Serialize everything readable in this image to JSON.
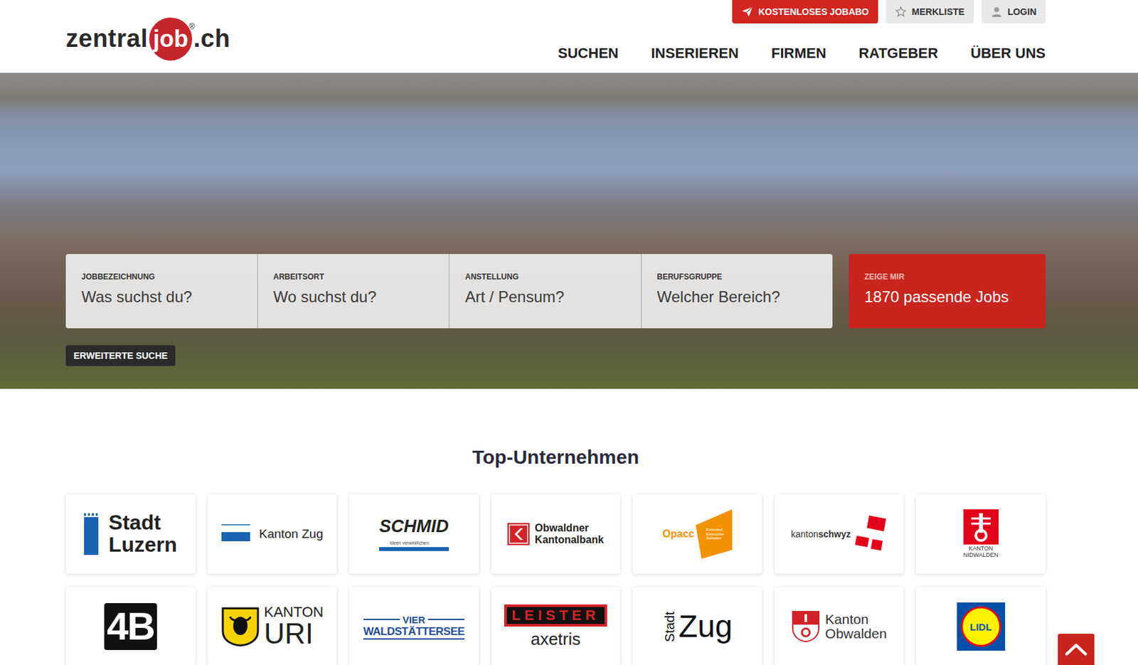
{
  "header": {
    "logo": {
      "before": "zentral",
      "highlight": "job",
      "mark": "®",
      "suffix": ".ch"
    },
    "top_buttons": [
      {
        "label": "KOSTENLOSES JOBABO",
        "kind": "primary"
      },
      {
        "label": "MERKLISTE",
        "kind": "star"
      },
      {
        "label": "LOGIN",
        "kind": "user"
      }
    ],
    "nav": [
      "SUCHEN",
      "INSERIEREN",
      "FIRMEN",
      "RATGEBER",
      "ÜBER UNS"
    ]
  },
  "search": {
    "fields": [
      {
        "label": "JOBBEZEICHNUNG",
        "placeholder": "Was suchst du?"
      },
      {
        "label": "ARBEITSORT",
        "placeholder": "Wo suchst du?"
      },
      {
        "label": "ANSTELLUNG",
        "placeholder": "Art / Pensum?"
      },
      {
        "label": "BERUFSGRUPPE",
        "placeholder": "Welcher Bereich?"
      }
    ],
    "submit": {
      "label": "ZEIGE MIR",
      "text": "1870 passende Jobs"
    },
    "advanced": "ERWEITERTE SUCHE"
  },
  "companies": {
    "title": "Top-Unternehmen",
    "items": [
      {
        "kind": "bar",
        "lines": [
          "Stadt",
          "Luzern"
        ],
        "color": "#1a64b4"
      },
      {
        "kind": "stripe",
        "lines": [
          "Kanton Zug"
        ],
        "color": "#1a64b4"
      },
      {
        "kind": "underline",
        "lines": [
          "SCHMID",
          "Ideen verwirklichen."
        ],
        "color": "#1a64b4"
      },
      {
        "kind": "square",
        "lines": [
          "Obwaldner",
          "Kantonalbank"
        ],
        "color": "#d2232a"
      },
      {
        "kind": "shape",
        "lines": [
          "Opacc",
          "Extended",
          "Enterprise",
          "Software"
        ],
        "color": "#f39200"
      },
      {
        "kind": "flag",
        "lines": [
          "kanton",
          "schwyz"
        ],
        "color": "#e3001b"
      },
      {
        "kind": "shield",
        "lines": [
          "KANTON",
          "NIDWALDEN"
        ],
        "color": "#e3001b"
      },
      {
        "kind": "block",
        "lines": [
          "4B"
        ],
        "color": "#111111"
      },
      {
        "kind": "bull",
        "lines": [
          "KANTON",
          "URI"
        ],
        "color": "#f6d200"
      },
      {
        "kind": "lines",
        "lines": [
          "VIER",
          "WALDSTÄTTERSEE"
        ],
        "color": "#1f4e9c"
      },
      {
        "kind": "box",
        "lines": [
          "LEISTER",
          "axetris"
        ],
        "color": "#d2232a"
      },
      {
        "kind": "vertical",
        "lines": [
          "Stadt",
          "Zug"
        ],
        "color": "#111111"
      },
      {
        "kind": "crest",
        "lines": [
          "Kanton",
          "Obwalden"
        ],
        "color": "#d2232a"
      },
      {
        "kind": "circle",
        "lines": [
          "LIDL"
        ],
        "color": "#0050aa"
      }
    ]
  },
  "scroll_top": {
    "enabled": true
  }
}
